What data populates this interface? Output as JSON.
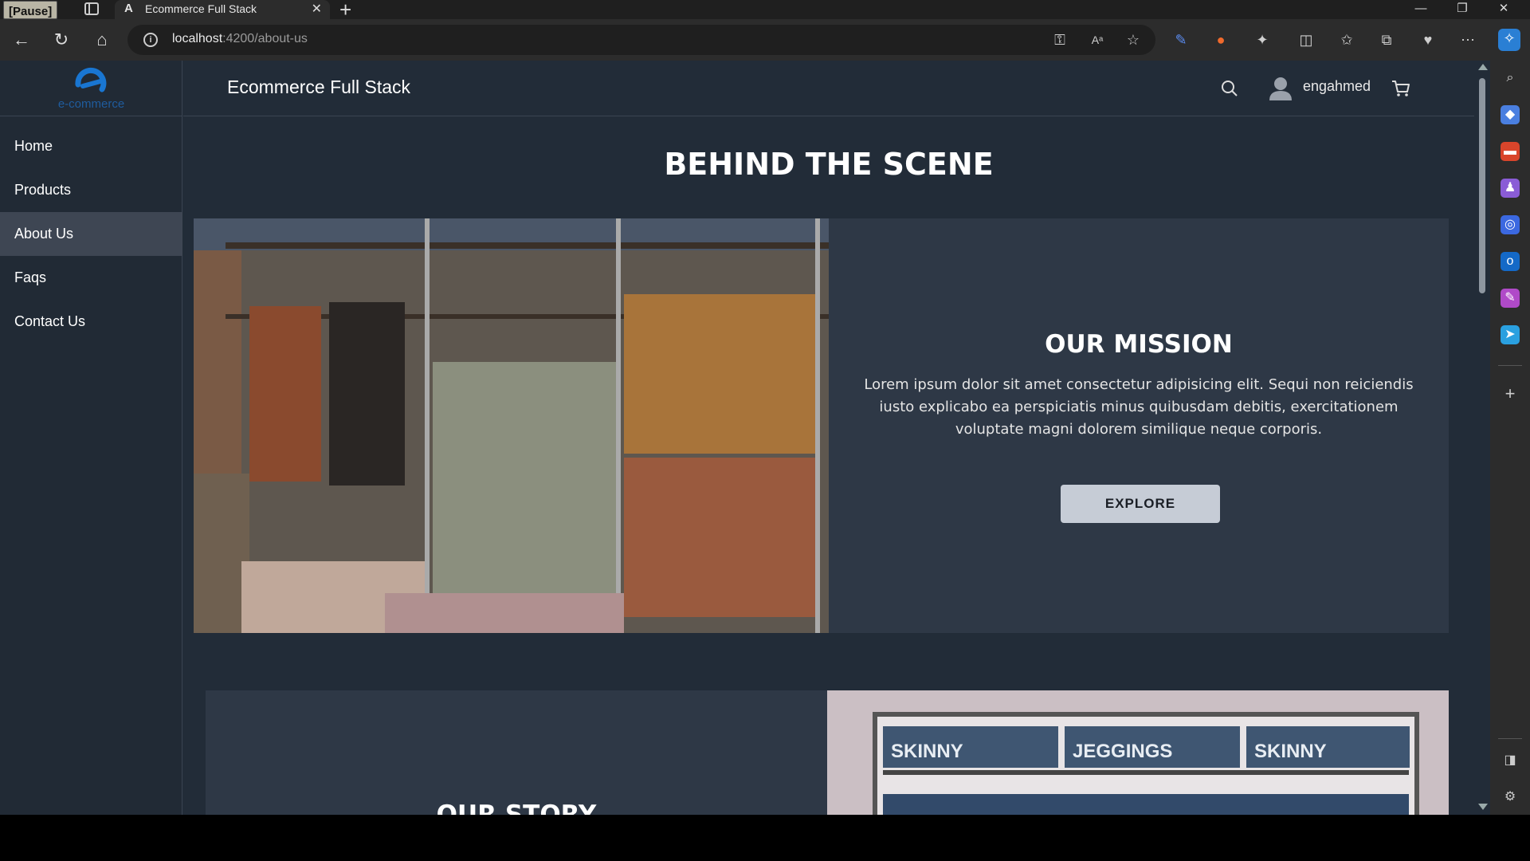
{
  "recorder": {
    "pause_label": "[Pause]"
  },
  "browser": {
    "tab_title": "Ecommerce Full Stack",
    "tab_favicon": "A",
    "url_host": "localhost",
    "url_path": ":4200/about-us"
  },
  "app": {
    "logo_text": "e-commerce",
    "brand": "Ecommerce Full Stack",
    "username": "engahmed",
    "nav": [
      {
        "label": "Home",
        "active": false
      },
      {
        "label": "Products",
        "active": false
      },
      {
        "label": "About Us",
        "active": true
      },
      {
        "label": "Faqs",
        "active": false
      },
      {
        "label": "Contact Us",
        "active": false
      }
    ]
  },
  "page": {
    "heading": "BEHIND THE SCENE",
    "mission": {
      "title": "OUR MISSION",
      "body": "Lorem ipsum dolor sit amet consectetur adipisicing elit. Sequi non reiciendis iusto explicabo ea perspiciatis minus quibusdam debitis, exercitationem voluptate magni dolorem similique neque corporis.",
      "button": "EXPLORE"
    },
    "story": {
      "title": "OUR STORY",
      "shelf_labels": [
        "SKINNY",
        "JEGGINGS",
        "SKINNY"
      ]
    }
  },
  "icons": {
    "search": "search-icon",
    "user": "user-avatar-icon",
    "cart": "cart-icon"
  }
}
